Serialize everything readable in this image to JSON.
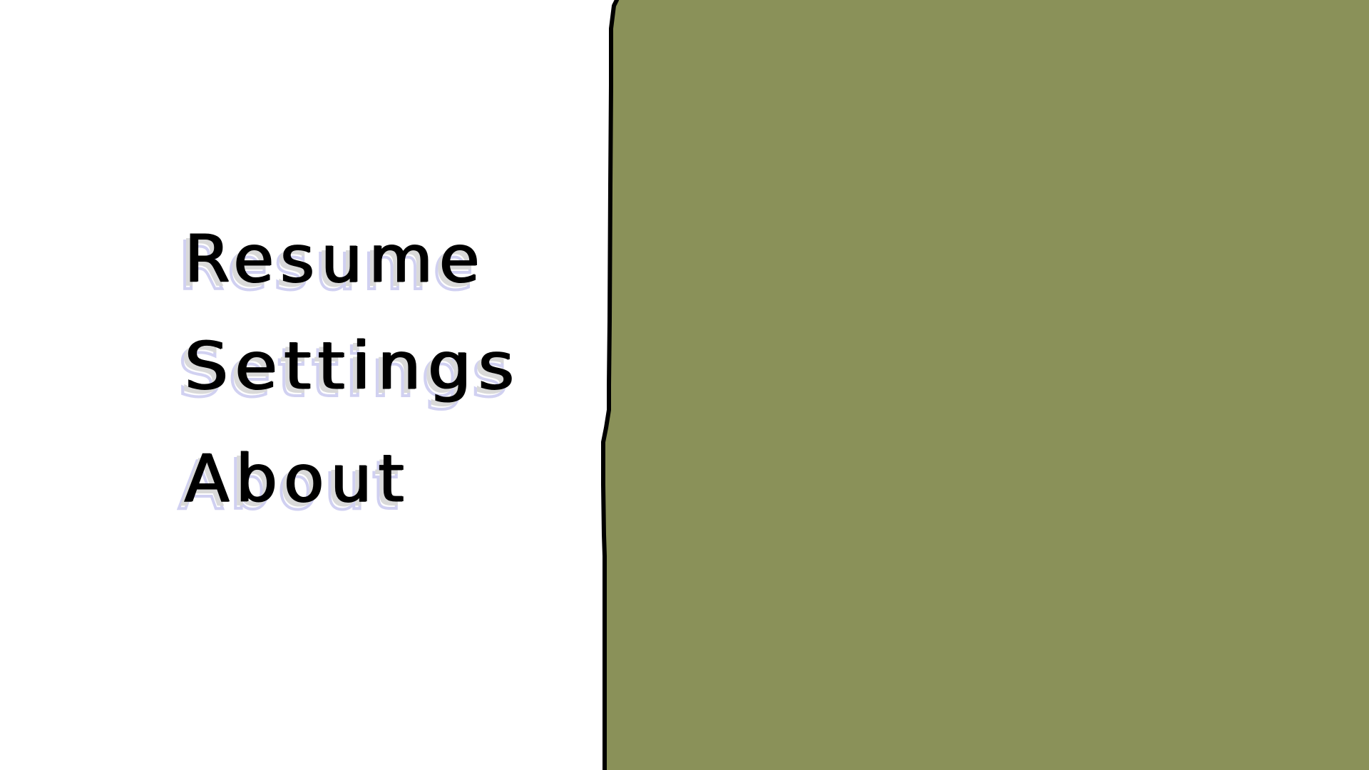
{
  "colors": {
    "background": "#ffffff",
    "field": "#8a9159",
    "outline": "#000000",
    "menu_text": "#000000",
    "menu_ghost": "#ccccf0",
    "menu_shadow": "#d9d9d9"
  },
  "menu": {
    "items": [
      {
        "label": "Resume"
      },
      {
        "label": "Settings"
      },
      {
        "label": "About"
      }
    ]
  }
}
